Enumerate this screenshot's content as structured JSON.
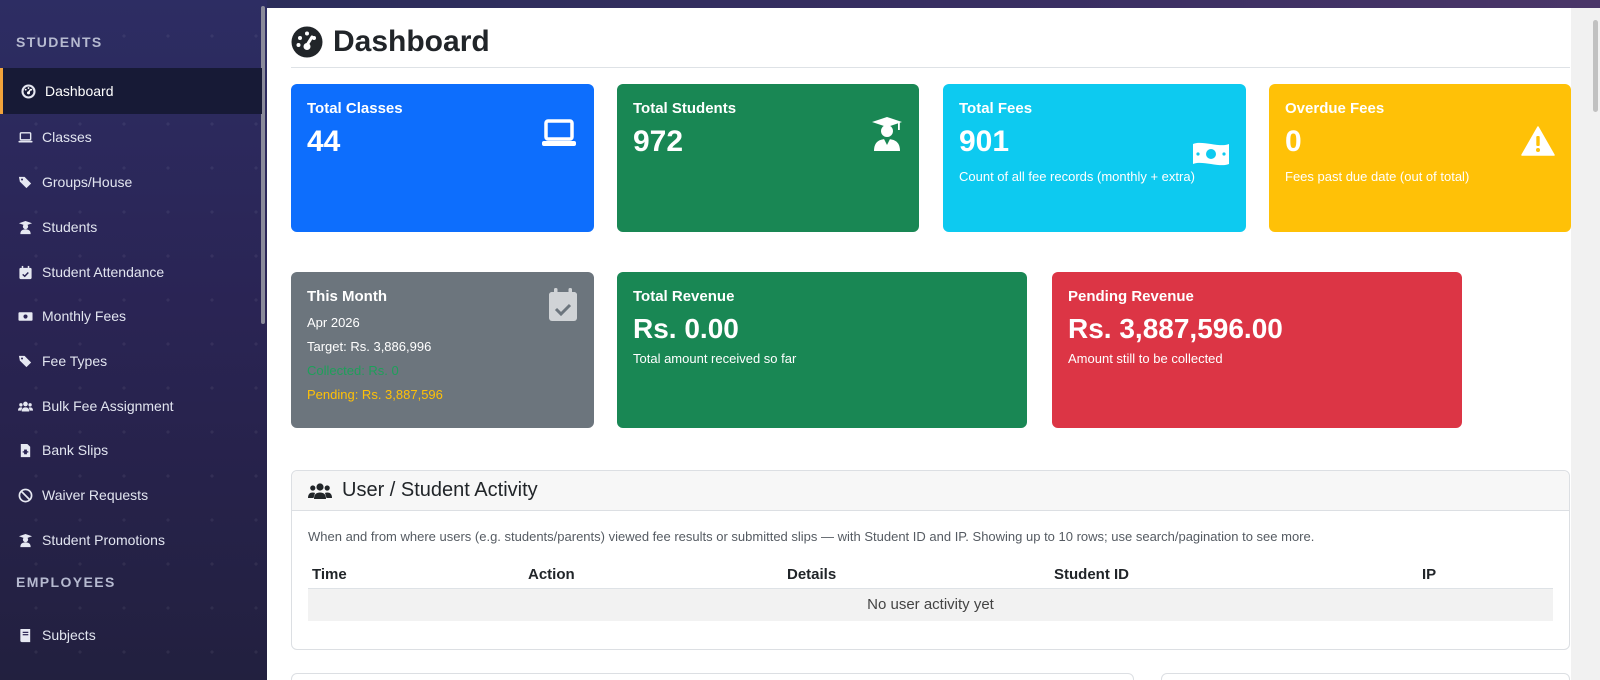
{
  "sidebar": {
    "sections": [
      {
        "heading": "STUDENTS"
      },
      {
        "heading": "EMPLOYEES"
      }
    ],
    "items": [
      {
        "label": "Dashboard",
        "icon": "gauge-icon",
        "active": true
      },
      {
        "label": "Classes",
        "icon": "laptop-icon"
      },
      {
        "label": "Groups/House",
        "icon": "tags-icon"
      },
      {
        "label": "Students",
        "icon": "user-graduate-icon"
      },
      {
        "label": "Student Attendance",
        "icon": "calendar-check-icon"
      },
      {
        "label": "Monthly Fees",
        "icon": "money-bill-icon"
      },
      {
        "label": "Fee Types",
        "icon": "tags-icon"
      },
      {
        "label": "Bulk Fee Assignment",
        "icon": "users-icon"
      },
      {
        "label": "Bank Slips",
        "icon": "file-invoice-icon"
      },
      {
        "label": "Waiver Requests",
        "icon": "ban-icon"
      },
      {
        "label": "Student Promotions",
        "icon": "user-graduate-icon"
      },
      {
        "label": "Subjects",
        "icon": "book-icon"
      }
    ]
  },
  "page": {
    "title": "Dashboard",
    "title_icon": "gauge-icon"
  },
  "stats": {
    "total_classes": {
      "label": "Total Classes",
      "value": "44",
      "icon": "laptop-icon"
    },
    "total_students": {
      "label": "Total Students",
      "value": "972",
      "icon": "user-graduate-icon"
    },
    "total_fees": {
      "label": "Total Fees",
      "value": "901",
      "sub": "Count of all fee records (monthly + extra)",
      "icon": "money-bill-icon"
    },
    "overdue_fees": {
      "label": "Overdue Fees",
      "value": "0",
      "sub": "Fees past due date (out of total)",
      "icon": "warning-icon"
    },
    "this_month": {
      "label": "This Month",
      "month": "Apr 2026",
      "target": "Target: Rs. 3,886,996",
      "collected": "Collected: Rs. 0",
      "pending": "Pending: Rs. 3,887,596",
      "icon": "calendar-check-icon"
    },
    "total_revenue": {
      "label": "Total Revenue",
      "value": "Rs. 0.00",
      "sub": "Total amount received so far"
    },
    "pending_revenue": {
      "label": "Pending Revenue",
      "value": "Rs. 3,887,596.00",
      "sub": "Amount still to be collected"
    }
  },
  "colors": {
    "blue": "#0d6efd",
    "green": "#198754",
    "cyan": "#0dcaf0",
    "yellow": "#ffc107",
    "gray": "#6c757d",
    "red": "#dc3545",
    "active_accent": "#f2a33b",
    "collected_text": "#1e9f5a",
    "pending_text": "#ffc107"
  },
  "activity": {
    "title": "User / Student Activity",
    "icon": "users-icon",
    "description": "When and from where users (e.g. students/parents) viewed fee results or submitted slips — with Student ID and IP. Showing up to 10 rows; use search/pagination to see more.",
    "columns": [
      "Time",
      "Action",
      "Details",
      "Student ID",
      "IP"
    ],
    "empty_text": "No user activity yet"
  }
}
